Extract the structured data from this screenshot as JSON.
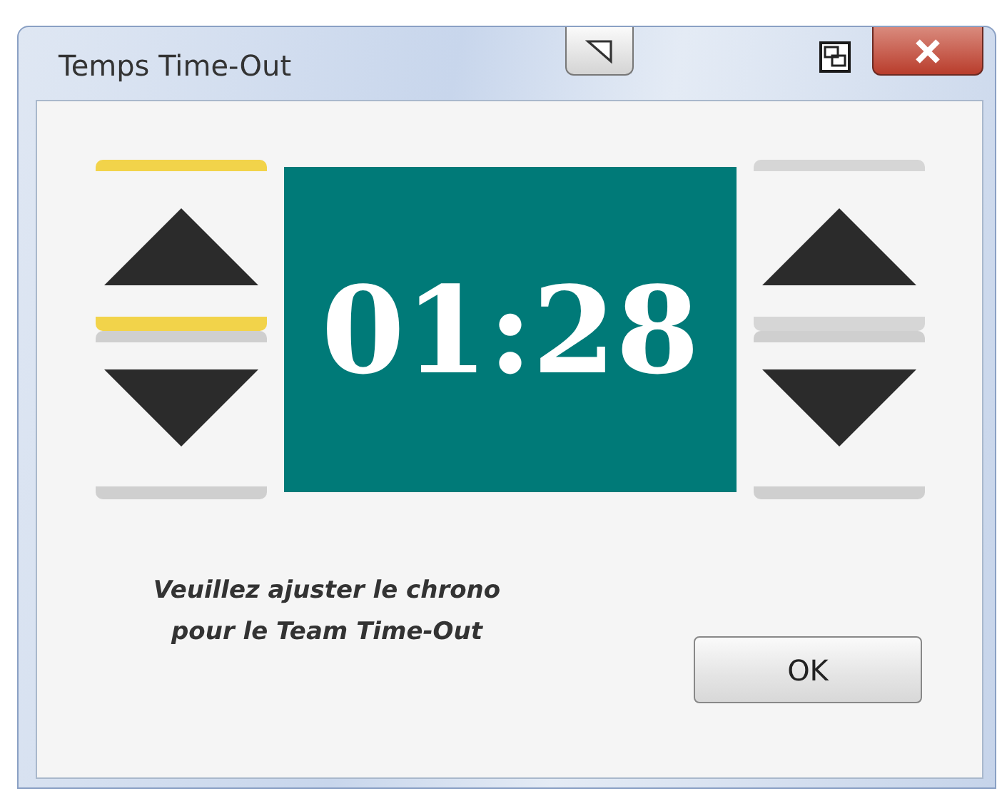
{
  "window": {
    "title": "Temps Time-Out"
  },
  "spinners": [
    {
      "highlighted": true
    },
    {
      "highlighted": false
    }
  ],
  "display": {
    "time": "01:28"
  },
  "message": "Veuillez ajuster le chrono\npour le Team Time-Out",
  "buttons": [
    {
      "label": "OK"
    }
  ]
}
